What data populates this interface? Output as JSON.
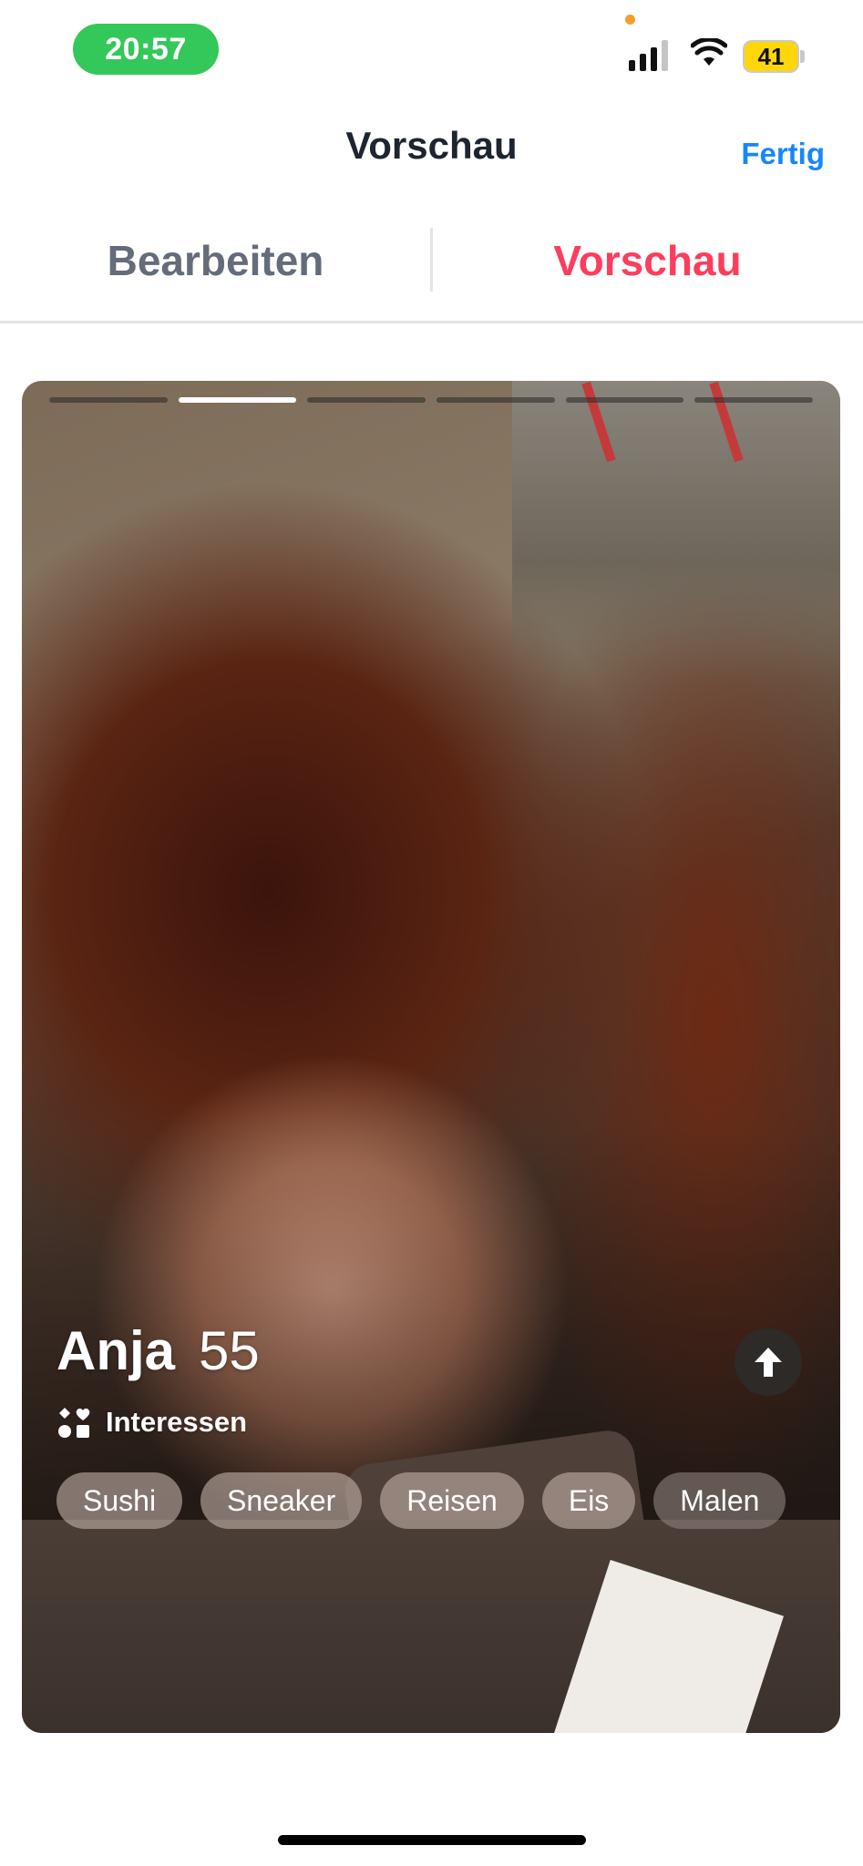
{
  "status_bar": {
    "time": "20:57",
    "battery": "41",
    "icons": [
      "signal-icon",
      "wifi-icon",
      "battery-icon"
    ]
  },
  "nav": {
    "title": "Vorschau",
    "done_label": "Fertig"
  },
  "tabs": [
    {
      "label": "Bearbeiten",
      "selected": false
    },
    {
      "label": "Vorschau",
      "selected": true
    }
  ],
  "profile": {
    "name": "Anja",
    "age": "55",
    "photo_count": 6,
    "current_photo_index": 2,
    "interests_label": "Interessen",
    "interests": [
      "Sushi",
      "Sneaker",
      "Reisen",
      "Eis",
      "Malen"
    ]
  },
  "colors": {
    "accent_blue": "#1786ff",
    "accent_red": "#fd3d5d",
    "status_green": "#34c759",
    "battery_yellow": "#ffd60a"
  }
}
